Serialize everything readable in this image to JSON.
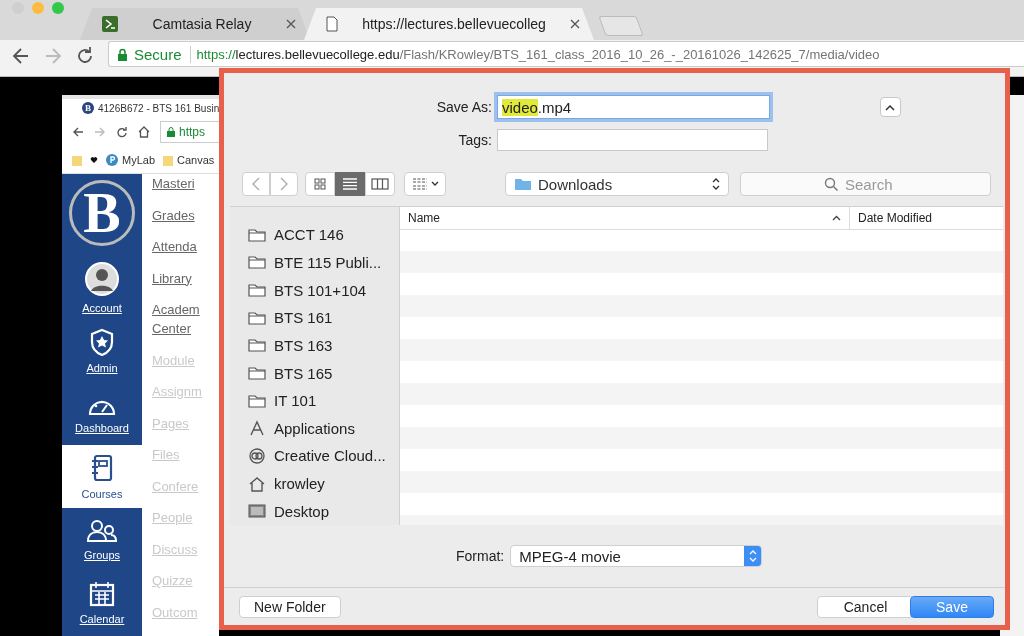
{
  "browser": {
    "tabs": [
      {
        "title": "Camtasia Relay",
        "kind": "app",
        "selected": false
      },
      {
        "title": "https://lectures.bellevuecolleg",
        "kind": "page",
        "selected": true
      }
    ],
    "address": {
      "security": "Secure",
      "scheme": "https://",
      "host": "lectures.bellevuecollege.edu",
      "path": "/Flash/KRowley/BTS_161_class_2016_10_26_-_20161026_142625_7/media/video"
    }
  },
  "recording": {
    "tab_title": "4126B672 - BTS 161 Busin",
    "address": "https",
    "bookmarks": [
      {
        "kind": "folder"
      },
      {
        "kind": "heart"
      },
      {
        "kind": "app",
        "label": "MyLab"
      },
      {
        "kind": "folder",
        "label": "Canvas"
      }
    ],
    "tab_logo": "B",
    "logo": "B",
    "global_nav": [
      {
        "label": "Account",
        "kind": "avatar",
        "selected": false
      },
      {
        "label": "Admin",
        "kind": "shield",
        "selected": false
      },
      {
        "label": "Dashboard",
        "kind": "gauge",
        "selected": false
      },
      {
        "label": "Courses",
        "kind": "notebook",
        "selected": true
      },
      {
        "label": "Groups",
        "kind": "people",
        "selected": false
      },
      {
        "label": "Calendar",
        "kind": "calendar",
        "selected": false
      }
    ],
    "course_nav": [
      {
        "label": "Masteri",
        "dimmed": false
      },
      {
        "label": "Grades",
        "dimmed": false
      },
      {
        "label": "Attenda",
        "dimmed": false
      },
      {
        "label": "Library",
        "dimmed": false
      },
      {
        "label": "Academ\nCenter",
        "dimmed": false
      },
      {
        "label": "Module",
        "dimmed": true
      },
      {
        "label": "Assignm",
        "dimmed": true
      },
      {
        "label": "Pages",
        "dimmed": true
      },
      {
        "label": "Files",
        "dimmed": true
      },
      {
        "label": "Confere",
        "dimmed": true
      },
      {
        "label": "People",
        "dimmed": true
      },
      {
        "label": "Discuss",
        "dimmed": true
      },
      {
        "label": "Quizze",
        "dimmed": true
      },
      {
        "label": "Outcom",
        "dimmed": true
      }
    ]
  },
  "dialog": {
    "save_as_label": "Save As:",
    "filename_highlighted": "video",
    "filename_rest": ".mp4",
    "tags_label": "Tags:",
    "views": [
      {
        "kind": "icons",
        "selected": false
      },
      {
        "kind": "list",
        "selected": true
      },
      {
        "kind": "columns",
        "selected": false
      }
    ],
    "location": "Downloads",
    "search_placeholder": "Search",
    "sidebar": [
      {
        "label": "ACCT 146",
        "kind": "folder"
      },
      {
        "label": "BTE 115 Publi...",
        "kind": "folder"
      },
      {
        "label": "BTS 101+104",
        "kind": "folder"
      },
      {
        "label": "BTS 161",
        "kind": "folder"
      },
      {
        "label": "BTS 163",
        "kind": "folder"
      },
      {
        "label": "BTS 165",
        "kind": "folder"
      },
      {
        "label": "IT 101",
        "kind": "folder"
      },
      {
        "label": "Applications",
        "kind": "apps"
      },
      {
        "label": "Creative Cloud...",
        "kind": "cloud"
      },
      {
        "label": "krowley",
        "kind": "home"
      },
      {
        "label": "Desktop",
        "kind": "desktop"
      }
    ],
    "columns": [
      {
        "label": "Name",
        "sorted": true
      },
      {
        "label": "Date Modified",
        "sorted": false
      }
    ],
    "format_label": "Format:",
    "format": "MPEG-4 movie",
    "buttons": [
      {
        "label": "New Folder",
        "kind": "secondary"
      },
      {
        "label": "Cancel",
        "kind": "secondary"
      },
      {
        "label": "Save",
        "kind": "default"
      }
    ]
  }
}
